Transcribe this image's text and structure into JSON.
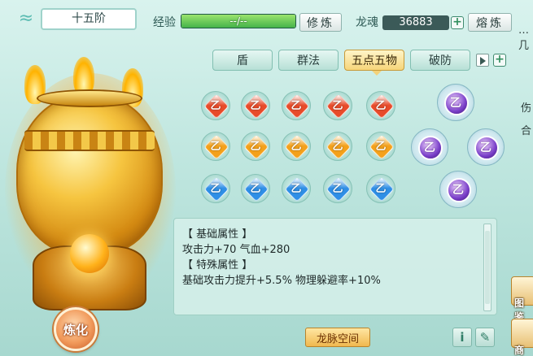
{
  "header": {
    "tier_label": "十五阶",
    "exp_label": "经验",
    "exp_value_text": "--/--",
    "exp_progress": 1.0,
    "refine_label": "修炼",
    "soul_label": "龙魂",
    "soul_value": "36883",
    "smelt_label": "熔炼"
  },
  "tabs": [
    {
      "label": "盾",
      "active": false
    },
    {
      "label": "群法",
      "active": false
    },
    {
      "label": "五点五物",
      "active": true
    },
    {
      "label": "破防",
      "active": false
    }
  ],
  "gem_rows": [
    {
      "color": "red",
      "count": 5,
      "symbol": "乙"
    },
    {
      "color": "orange",
      "count": 5,
      "symbol": "乙"
    },
    {
      "color": "blue",
      "count": 5,
      "symbol": "乙"
    }
  ],
  "star_gems": {
    "count": 4,
    "symbol": "乙",
    "color": "purple"
  },
  "attributes": {
    "base_header": "【 基础属性 】",
    "base_line": "攻击力+70  气血+280",
    "special_header": "【 特殊属性 】",
    "special_line": "基础攻击力提升+5.5%  物理躲避率+10%"
  },
  "buttons": {
    "smelt_big": "炼化",
    "dragon_vein": "龙脉空间",
    "info_icon_glyph": "i",
    "note_icon_glyph": "✎",
    "plus_glyph": "+"
  },
  "edge_hud": {
    "partial_text_1": "…几",
    "partial_text_2": "伤",
    "partial_text_3": "合",
    "card_1_label": "图鉴",
    "card_2_label": "商店"
  },
  "colors": {
    "red_gem": "#e84b2a",
    "orange_gem": "#f4a11b",
    "blue_gem": "#2f8fe6",
    "purple_gem": "#7a3fc9",
    "accent": "#f0b84f"
  }
}
